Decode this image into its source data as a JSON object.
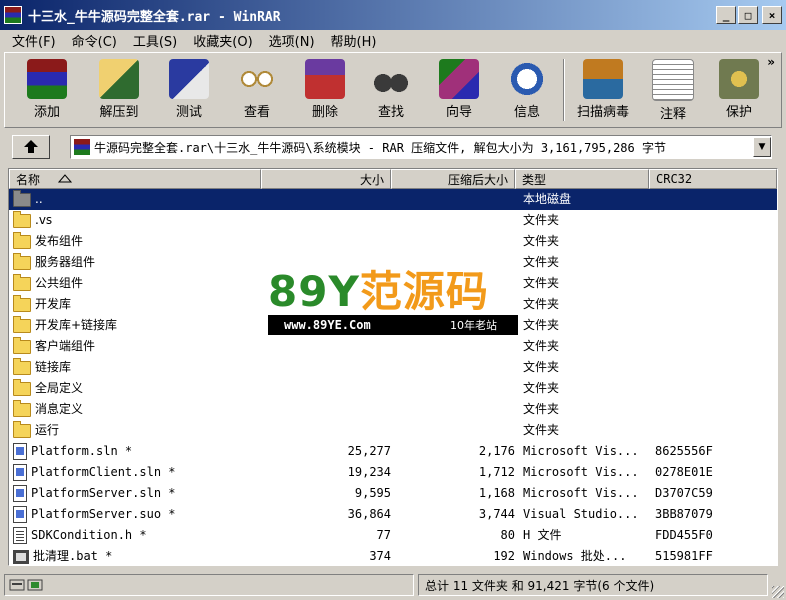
{
  "window": {
    "title": "十三水_牛牛源码完整全套.rar - WinRAR",
    "min": "_",
    "max": "□",
    "close": "×"
  },
  "menu": [
    {
      "id": "file",
      "label": "文件(F)"
    },
    {
      "id": "commands",
      "label": "命令(C)"
    },
    {
      "id": "tools",
      "label": "工具(S)"
    },
    {
      "id": "favorites",
      "label": "收藏夹(O)"
    },
    {
      "id": "options",
      "label": "选项(N)"
    },
    {
      "id": "help",
      "label": "帮助(H)"
    }
  ],
  "toolbar": {
    "more": "»",
    "tools": [
      {
        "id": "add",
        "label": "添加",
        "icon": "add-archive-icon",
        "color": "#6a3aa0"
      },
      {
        "id": "extract",
        "label": "解压到",
        "icon": "extract-to-icon",
        "color": "#2f6b2f"
      },
      {
        "id": "test",
        "label": "测试",
        "icon": "test-icon",
        "color": "#2a3aa0"
      },
      {
        "id": "view",
        "label": "查看",
        "icon": "view-glasses-icon",
        "color": "#b08a3a"
      },
      {
        "id": "delete",
        "label": "删除",
        "icon": "delete-icon",
        "color": "#c03030"
      },
      {
        "id": "find",
        "label": "查找",
        "icon": "find-binoculars-icon",
        "color": "#3a3a3a"
      },
      {
        "id": "wizard",
        "label": "向导",
        "icon": "wizard-icon",
        "color": "#a0307a"
      },
      {
        "id": "info",
        "label": "信息",
        "icon": "info-icon",
        "color": "#2a5ab0"
      },
      {
        "id": "scan",
        "label": "扫描病毒",
        "icon": "virus-scan-icon",
        "color": "#c07a20"
      },
      {
        "id": "comment",
        "label": "注释",
        "icon": "comment-icon",
        "color": "#8a8a8a"
      },
      {
        "id": "protect",
        "label": "保护",
        "icon": "protect-shield-icon",
        "color": "#707a50"
      }
    ]
  },
  "path": {
    "text": "牛源码完整全套.rar\\十三水_牛牛源码\\系统模块 - RAR 压缩文件, 解包大小为 3,161,795,286 字节"
  },
  "columns": {
    "name": "名称",
    "size": "大小",
    "packed": "压缩后大小",
    "type": "类型",
    "crc": "CRC32"
  },
  "rows": [
    {
      "name": "..",
      "size": "",
      "packed": "",
      "type": "本地磁盘",
      "crc": "",
      "icon": "up-folder-icon",
      "kind": "up",
      "selected": true
    },
    {
      "name": ".vs",
      "size": "",
      "packed": "",
      "type": "文件夹",
      "crc": "",
      "icon": "folder-icon",
      "kind": "folder"
    },
    {
      "name": "发布组件",
      "size": "",
      "packed": "",
      "type": "文件夹",
      "crc": "",
      "icon": "folder-icon",
      "kind": "folder"
    },
    {
      "name": "服务器组件",
      "size": "",
      "packed": "",
      "type": "文件夹",
      "crc": "",
      "icon": "folder-icon",
      "kind": "folder"
    },
    {
      "name": "公共组件",
      "size": "",
      "packed": "",
      "type": "文件夹",
      "crc": "",
      "icon": "folder-icon",
      "kind": "folder"
    },
    {
      "name": "开发库",
      "size": "",
      "packed": "",
      "type": "文件夹",
      "crc": "",
      "icon": "folder-icon",
      "kind": "folder"
    },
    {
      "name": "开发库+链接库",
      "size": "",
      "packed": "",
      "type": "文件夹",
      "crc": "",
      "icon": "folder-icon",
      "kind": "folder"
    },
    {
      "name": "客户端组件",
      "size": "",
      "packed": "",
      "type": "文件夹",
      "crc": "",
      "icon": "folder-icon",
      "kind": "folder"
    },
    {
      "name": "链接库",
      "size": "",
      "packed": "",
      "type": "文件夹",
      "crc": "",
      "icon": "folder-icon",
      "kind": "folder"
    },
    {
      "name": "全局定义",
      "size": "",
      "packed": "",
      "type": "文件夹",
      "crc": "",
      "icon": "folder-icon",
      "kind": "folder"
    },
    {
      "name": "消息定义",
      "size": "",
      "packed": "",
      "type": "文件夹",
      "crc": "",
      "icon": "folder-icon",
      "kind": "folder"
    },
    {
      "name": "运行",
      "size": "",
      "packed": "",
      "type": "文件夹",
      "crc": "",
      "icon": "folder-icon",
      "kind": "folder"
    },
    {
      "name": "Platform.sln *",
      "size": "25,277",
      "packed": "2,176",
      "type": "Microsoft Vis...",
      "crc": "8625556F",
      "icon": "sln-file-icon",
      "kind": "file"
    },
    {
      "name": "PlatformClient.sln *",
      "size": "19,234",
      "packed": "1,712",
      "type": "Microsoft Vis...",
      "crc": "0278E01E",
      "icon": "sln-file-icon",
      "kind": "file"
    },
    {
      "name": "PlatformServer.sln *",
      "size": "9,595",
      "packed": "1,168",
      "type": "Microsoft Vis...",
      "crc": "D3707C59",
      "icon": "sln-file-icon",
      "kind": "file"
    },
    {
      "name": "PlatformServer.suo *",
      "size": "36,864",
      "packed": "3,744",
      "type": "Visual Studio...",
      "crc": "3BB87079",
      "icon": "suo-file-icon",
      "kind": "file"
    },
    {
      "name": "SDKCondition.h *",
      "size": "77",
      "packed": "80",
      "type": "H 文件",
      "crc": "FDD455F0",
      "icon": "header-file-icon",
      "kind": "txt"
    },
    {
      "name": "批清理.bat *",
      "size": "374",
      "packed": "192",
      "type": "Windows 批处...",
      "crc": "515981FF",
      "icon": "batch-file-icon",
      "kind": "bat"
    }
  ],
  "watermark": {
    "big_green": "89Y",
    "big_orange": "范源码",
    "url": "www.89YE.Com",
    "tag": "10年老站"
  },
  "status": {
    "right": "总计 11 文件夹 和 91,421 字节(6 个文件)"
  }
}
